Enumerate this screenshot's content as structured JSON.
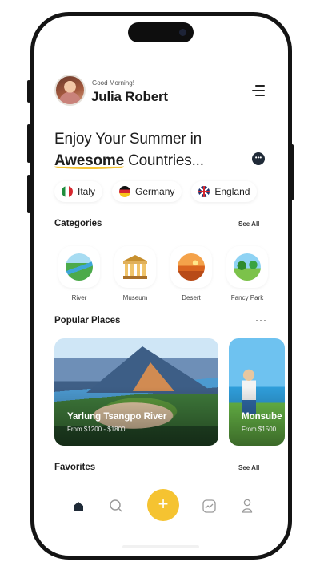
{
  "header": {
    "greeting": "Good Morning!",
    "user_name": "Julia Robert"
  },
  "headline": {
    "line1": "Enjoy Your Summer in",
    "accent": "Awesome",
    "line2_rest": " Countries..."
  },
  "countries": [
    {
      "label": "Italy",
      "flag": "italy-flag"
    },
    {
      "label": "Germany",
      "flag": "germany-flag"
    },
    {
      "label": "England",
      "flag": "england-flag"
    }
  ],
  "categories": {
    "title": "Categories",
    "see_all": "See All",
    "items": [
      {
        "label": "River",
        "icon": "river-icon"
      },
      {
        "label": "Museum",
        "icon": "museum-icon"
      },
      {
        "label": "Desert",
        "icon": "desert-icon"
      },
      {
        "label": "Fancy Park",
        "icon": "park-icon"
      }
    ]
  },
  "popular": {
    "title": "Popular Places",
    "more": "···",
    "places": [
      {
        "name": "Yarlung Tsangpo River",
        "price": "From $1200 - $1800"
      },
      {
        "name": "Monsube",
        "price": "From $1500"
      }
    ]
  },
  "favorites": {
    "title": "Favorites",
    "see_all": "See All"
  },
  "nav": {
    "add_label": "+",
    "items": [
      "home-icon",
      "search-icon",
      "add-icon",
      "stats-icon",
      "profile-icon"
    ]
  },
  "colors": {
    "accent": "#f5c331",
    "text": "#1e1e1e",
    "frame": "#141414"
  }
}
